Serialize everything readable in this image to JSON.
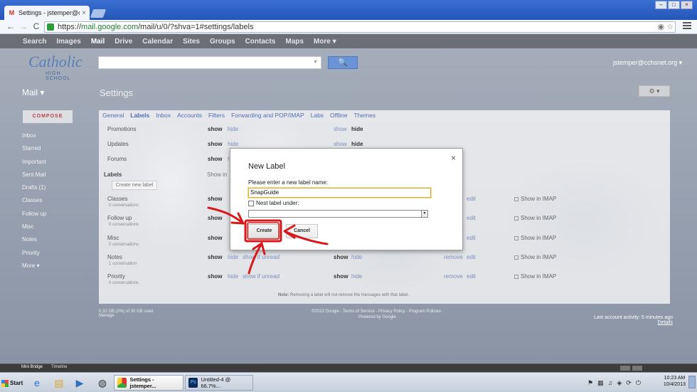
{
  "browser": {
    "tab_title": "Settings - jstemper@cchsnet",
    "tab_close": "×",
    "url_scheme": "https://",
    "url_host": "mail.google.com",
    "url_path": "/mail/u/0/?shva=1#settings/labels",
    "back_glyph": "←",
    "forward_glyph": "→",
    "reload_glyph": "C",
    "minimize_glyph": "–",
    "maximize_glyph": "□",
    "close_glyph": "×"
  },
  "gbar": {
    "items": [
      "Search",
      "Images",
      "Mail",
      "Drive",
      "Calendar",
      "Sites",
      "Groups",
      "Contacts",
      "Maps",
      "More ▾"
    ]
  },
  "header": {
    "logo_line1": "Catholic",
    "logo_line2": "HIGH SCHOOL",
    "search_button": "🔍",
    "account": "jstemper@cchsnet.org ▾"
  },
  "left": {
    "mail_label": "Mail ▾",
    "compose": "COMPOSE",
    "nav": [
      "Inbox",
      "Starred",
      "Important",
      "Sent Mail",
      "Drafts (1)",
      "Classes",
      "Follow up",
      "Misc",
      "Notes",
      "Priority",
      "More ▾"
    ]
  },
  "settings": {
    "title": "Settings",
    "gear": "⚙ ▾",
    "tabs": [
      "General",
      "Labels",
      "Inbox",
      "Accounts",
      "Filters",
      "Forwarding and POP/IMAP",
      "Labs",
      "Offline",
      "Themes"
    ],
    "system_rows": [
      {
        "name": "Promotions",
        "show": "show",
        "hide": "hide",
        "show2": "show",
        "hide2": "hide"
      },
      {
        "name": "Updates",
        "show": "show",
        "hide": "hide",
        "show2": "show",
        "hide2": "hide"
      },
      {
        "name": "Forums",
        "show": "show",
        "hide": "hide",
        "show2": "show",
        "hide2": "hide"
      }
    ],
    "labels_heading": "Labels",
    "labels_show_in": "Show in",
    "create_new_label": "Create new label",
    "user_labels": [
      {
        "name": "Classes",
        "sub": "0 conversations",
        "show": "show",
        "remove": "remove",
        "edit": "edit",
        "imap": "Show in IMAP"
      },
      {
        "name": "Follow up",
        "sub": "0 conversations",
        "show": "show",
        "remove": "remove",
        "edit": "edit",
        "imap": "Show in IMAP"
      },
      {
        "name": "Misc",
        "sub": "0 conversations",
        "show": "show",
        "remove": "remove",
        "edit": "edit",
        "imap": "Show in IMAP"
      },
      {
        "name": "Notes",
        "sub": "1 conversation",
        "show": "show",
        "hide": "hide",
        "show_if_unread": "show if unread",
        "show2": "show",
        "hide2": "hide",
        "remove": "remove",
        "edit": "edit",
        "imap": "Show in IMAP"
      },
      {
        "name": "Priority",
        "sub": "0 conversations",
        "show": "show",
        "hide": "hide",
        "show_if_unread": "show if unread",
        "show2": "show",
        "hide2": "hide",
        "remove": "remove",
        "edit": "edit",
        "imap": "Show in IMAP"
      }
    ],
    "note_bold": "Note:",
    "note": "Removing a label will not remove the messages with that label."
  },
  "footer": {
    "left": "0.32 GB (2%) of 30 GB used",
    "left2": "Manage",
    "mid": "©2013 Google - Terms of Service - Privacy Policy - Program Policies",
    "mid2": "Powered by Google",
    "right": "Last account activity: 5 minutes ago",
    "right2": "Details"
  },
  "dialog": {
    "title": "New Label",
    "close": "×",
    "prompt": "Please enter a new label name:",
    "input_value": "SnapGuide",
    "nest_label": "Nest label under:",
    "select_arrow": "▼",
    "create": "Create",
    "cancel": "Cancel"
  },
  "bridge": {
    "tab1": "Mini Bridge",
    "tab2": "Timeline"
  },
  "taskbar": {
    "start": "Start",
    "task_chrome": "Settings - jstemper...",
    "task_ps": "Untitled-4 @ 66.7%...",
    "ps_badge": "Ps",
    "time": "10:23 AM",
    "date": "10/4/2013"
  },
  "colors": {
    "accent": "#4f6fb7",
    "annotation": "#d7191c"
  }
}
